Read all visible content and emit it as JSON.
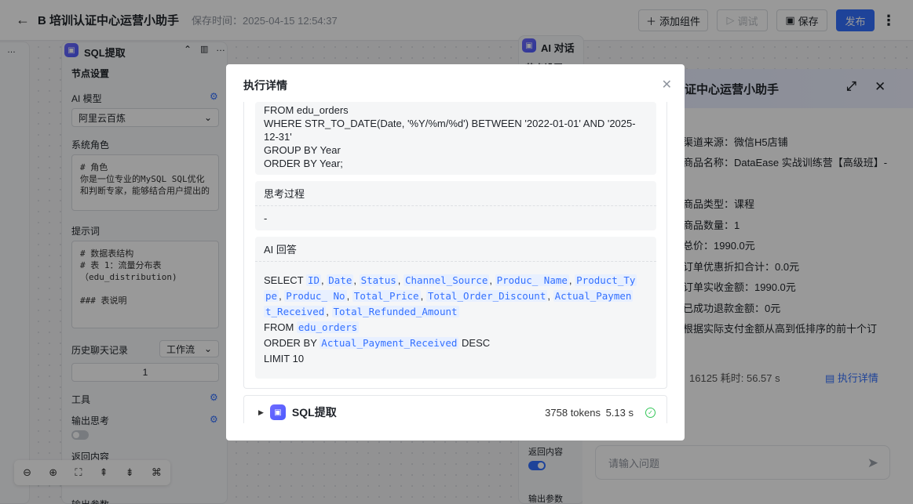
{
  "header": {
    "title": "B 培训认证中心运营小助手",
    "save_time": "保存时间：2025-04-15 12:54:37",
    "add_component": "添加组件",
    "debug": "调试",
    "save": "保存",
    "publish": "发布"
  },
  "sql_node": {
    "title": "SQL提取",
    "node_settings": "节点设置",
    "ai_model_label": "AI 模型",
    "ai_model_value": "阿里云百炼",
    "system_role_label": "系统角色",
    "system_role_text": "# 角色\n你是一位专业的MySQL SQL优化\n和判断专家，能够结合用户提出的",
    "prompt_label": "提示词",
    "prompt_text": "# 数据表结构\n# 表 1：流量分布表\n（edu_distribution)\n\n### 表说明",
    "history_label": "历史聊天记录",
    "history_mode": "工作流",
    "history_count": "1",
    "tools_label": "工具",
    "output_thinking_label": "输出思考",
    "return_content_label": "返回内容",
    "output_params_label": "输出参数"
  },
  "ai_node": {
    "title": "AI 对话",
    "node_settings": "节点设置",
    "return_content_label": "返回内容",
    "output_params_label": "输出参数"
  },
  "chat": {
    "title": "证中心运营小助手",
    "lines": [
      "渠道来源：微信H5店铺",
      "商品名称：DataEase 实战训练营【高级班】-",
      "商品类型：课程",
      "商品数量：1",
      "总价：1990.0元",
      "订单优惠折扣合计：0.0元",
      "订单实收金额：1990.0元",
      "已成功退款金额：0元",
      "根据实际支付金额从高到低排序的前十个订"
    ],
    "stats": "16125  耗时: 56.57 s",
    "detail_link": "执行详情",
    "input_placeholder": "请输入问题"
  },
  "modal": {
    "title": "执行详情",
    "sql_lines": [
      "FROM edu_orders",
      "WHERE STR_TO_DATE(Date, '%Y/%m/%d') BETWEEN '2022-01-01' AND '2025-",
      "12-31'",
      "GROUP BY Year",
      "ORDER BY Year;"
    ],
    "thinking_title": "思考过程",
    "thinking_value": "-",
    "answer_title": "AI 回答",
    "answer": {
      "select": "SELECT",
      "cols1": [
        "ID",
        "Date",
        "Status",
        "Channel_Source",
        "Produc_ Name",
        "Product_Ty"
      ],
      "cols2_prefix": "pe",
      "cols2": [
        "Produc_ No",
        "Total_Price",
        "Total_Order_Discount",
        "Actual_Paymen"
      ],
      "cols3_prefix": "t_Received",
      "cols3": [
        "Total_Refunded_Amount"
      ],
      "from": "FROM",
      "table": "edu_orders",
      "order_by": "ORDER BY",
      "order_col": "Actual_Payment_Received",
      "desc": "DESC",
      "limit": "LIMIT 10"
    },
    "collapsed_node": {
      "name": "SQL提取",
      "tokens": "3758 tokens",
      "time": "5.13 s"
    }
  },
  "zoom_toolbar": {
    "icons": [
      "zoom-out-icon",
      "zoom-in-icon",
      "fit-view-icon",
      "collapse-icon",
      "expand-icon",
      "layout-icon"
    ]
  }
}
